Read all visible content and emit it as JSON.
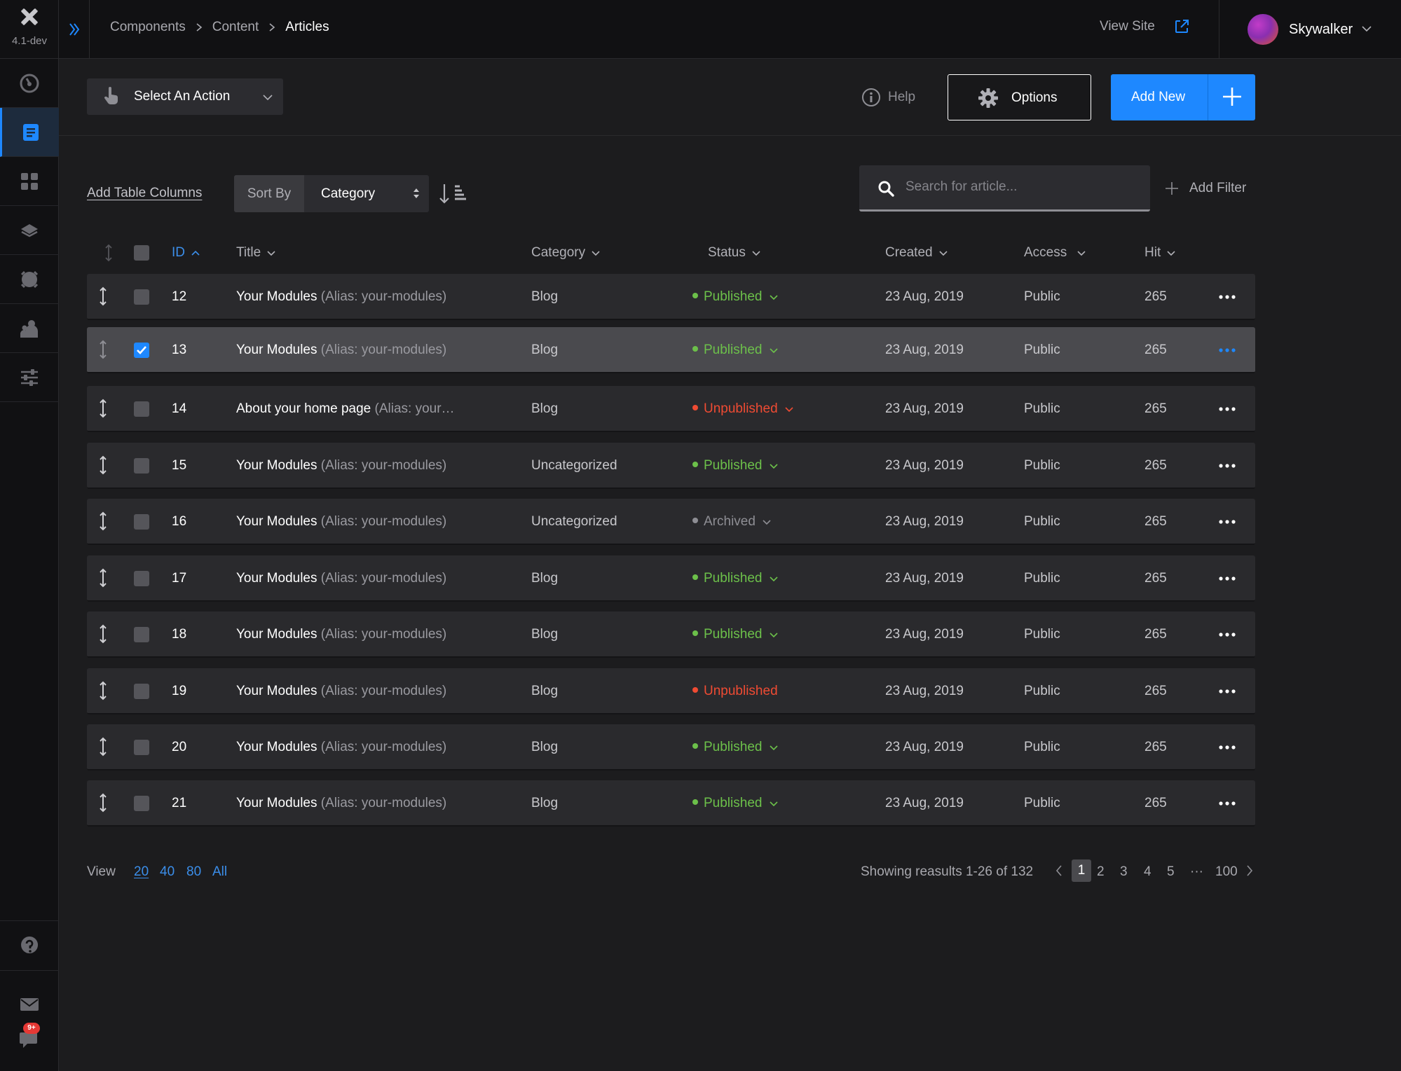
{
  "app": {
    "version": "4.1-dev"
  },
  "breadcrumb": {
    "items": [
      "Components",
      "Content",
      "Articles"
    ]
  },
  "header": {
    "view_site": "View Site",
    "user_name": "Skywalker"
  },
  "toolbar": {
    "select_action": "Select An Action",
    "help": "Help",
    "options": "Options",
    "add_new": "Add New"
  },
  "filters": {
    "add_columns": "Add Table Columns",
    "sort_by_label": "Sort By",
    "sort_by_value": "Category",
    "search_placeholder": "Search for article...",
    "add_filter": "Add Filter"
  },
  "table": {
    "columns": [
      "ID",
      "Title",
      "Category",
      "Status",
      "Created",
      "Access",
      "Hit"
    ],
    "rows": [
      {
        "id": "12",
        "title": "Your Modules",
        "alias": "(Alias: your-modules)",
        "category": "Blog",
        "status": "Published",
        "status_type": "published",
        "dropdown": true,
        "created": "23 Aug, 2019",
        "access": "Public",
        "hits": "265",
        "checked": false
      },
      {
        "id": "13",
        "title": "Your Modules",
        "alias": "(Alias: your-modules)",
        "category": "Blog",
        "status": "Published",
        "status_type": "published",
        "dropdown": true,
        "created": "23 Aug, 2019",
        "access": "Public",
        "hits": "265",
        "checked": true
      },
      {
        "id": "14",
        "title": "About your home page",
        "alias": "(Alias: your…",
        "category": "Blog",
        "status": "Unpublished",
        "status_type": "unpublished",
        "dropdown": true,
        "created": "23 Aug, 2019",
        "access": "Public",
        "hits": "265",
        "checked": false
      },
      {
        "id": "15",
        "title": "Your Modules",
        "alias": "(Alias: your-modules)",
        "category": "Uncategorized",
        "status": "Published",
        "status_type": "published",
        "dropdown": true,
        "created": "23 Aug, 2019",
        "access": "Public",
        "hits": "265",
        "checked": false
      },
      {
        "id": "16",
        "title": "Your Modules",
        "alias": "(Alias: your-modules)",
        "category": "Uncategorized",
        "status": "Archived",
        "status_type": "archived",
        "dropdown": true,
        "created": "23 Aug, 2019",
        "access": "Public",
        "hits": "265",
        "checked": false
      },
      {
        "id": "17",
        "title": "Your Modules",
        "alias": "(Alias: your-modules)",
        "category": "Blog",
        "status": "Published",
        "status_type": "published",
        "dropdown": true,
        "created": "23 Aug, 2019",
        "access": "Public",
        "hits": "265",
        "checked": false
      },
      {
        "id": "18",
        "title": "Your Modules",
        "alias": "(Alias: your-modules)",
        "category": "Blog",
        "status": "Published",
        "status_type": "published",
        "dropdown": true,
        "created": "23 Aug, 2019",
        "access": "Public",
        "hits": "265",
        "checked": false
      },
      {
        "id": "19",
        "title": "Your Modules",
        "alias": "(Alias: your-modules)",
        "category": "Blog",
        "status": "Unpublished",
        "status_type": "unpublished",
        "dropdown": false,
        "created": "23 Aug, 2019",
        "access": "Public",
        "hits": "265",
        "checked": false
      },
      {
        "id": "20",
        "title": "Your Modules",
        "alias": "(Alias: your-modules)",
        "category": "Blog",
        "status": "Published",
        "status_type": "published",
        "dropdown": true,
        "created": "23 Aug, 2019",
        "access": "Public",
        "hits": "265",
        "checked": false
      },
      {
        "id": "21",
        "title": "Your Modules",
        "alias": "(Alias: your-modules)",
        "category": "Blog",
        "status": "Published",
        "status_type": "published",
        "dropdown": true,
        "created": "23 Aug, 2019",
        "access": "Public",
        "hits": "265",
        "checked": false
      }
    ]
  },
  "pagination": {
    "view_label": "View",
    "view_options": [
      "20",
      "40",
      "80",
      "All"
    ],
    "results": "Showing reasults 1-26 of 132",
    "pages": [
      "1",
      "2",
      "3",
      "4",
      "5",
      "···",
      "100"
    ],
    "current_page": "1"
  },
  "notifications": {
    "badge": "9+"
  },
  "colors": {
    "accent": "#1e88ff",
    "published": "#6cc04a",
    "unpublished": "#ef4b33",
    "archived": "#8e8e94",
    "background": "#1c1c1e"
  },
  "icons": {
    "sidebar": [
      "dashboard-icon",
      "articles-icon",
      "modules-icon",
      "layers-icon",
      "media-icon",
      "users-icon",
      "settings-sliders-icon"
    ],
    "sidebar_bottom": [
      "help-icon",
      "mail-icon",
      "notifications-icon"
    ]
  }
}
